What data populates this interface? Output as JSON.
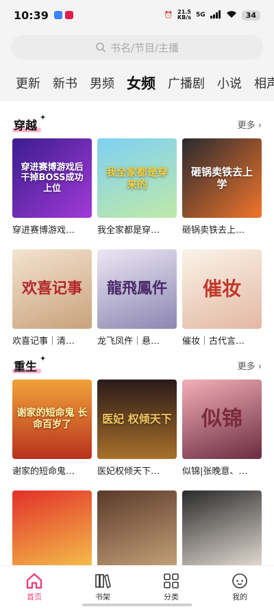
{
  "status": {
    "time": "10:39",
    "speed_value": "21.5",
    "speed_unit": "KB/s",
    "network": "5G",
    "battery": "34"
  },
  "search": {
    "placeholder": "书名/节目/主播"
  },
  "tabs": [
    "更新",
    "新书",
    "男频",
    "女频",
    "广播剧",
    "小说",
    "相声"
  ],
  "active_tab": "女频",
  "sections": [
    {
      "title": "穿越",
      "more": "更多",
      "books": [
        {
          "title": "穿进赛博游戏…",
          "cover_text": "穿进赛博游戏后 干掉BOSS成功上位",
          "colors": [
            "#3a1d8f",
            "#a23ad6"
          ]
        },
        {
          "title": "我全家都是穿…",
          "cover_text": "我全家都是穿来的",
          "colors": [
            "#7fd0f2",
            "#bfe9a8"
          ]
        },
        {
          "title": "砸锅卖铁去上…",
          "cover_text": "砸锅卖铁去上学",
          "colors": [
            "#2a2a30",
            "#f0742a"
          ]
        },
        {
          "title": "欢喜记事｜清…",
          "cover_text": "欢喜记事",
          "colors": [
            "#f3e3cf",
            "#c9a27c"
          ]
        },
        {
          "title": "龙飞凤仵｜悬…",
          "cover_text": "龍飛鳳仵",
          "colors": [
            "#ece7f4",
            "#8c86b2"
          ]
        },
        {
          "title": "催妆｜古代言…",
          "cover_text": "催妆",
          "colors": [
            "#fbf3e8",
            "#e3b8a3"
          ]
        }
      ]
    },
    {
      "title": "重生",
      "more": "更多",
      "books": [
        {
          "title": "谢家的短命鬼…",
          "cover_text": "谢家的短命鬼 长命百岁了",
          "colors": [
            "#f2a23a",
            "#b8321c"
          ]
        },
        {
          "title": "医妃权倾天下…",
          "cover_text": "医妃 权倾天下",
          "colors": [
            "#2a1a1a",
            "#a8702a"
          ]
        },
        {
          "title": "似锦|张晚意、…",
          "cover_text": "似锦",
          "colors": [
            "#f3b0b8",
            "#6b2b40"
          ]
        },
        {
          "title": "",
          "cover_text": "",
          "colors": [
            "#e2302a",
            "#f5c24a"
          ]
        },
        {
          "title": "",
          "cover_text": "",
          "colors": [
            "#5a3a2a",
            "#c7a37a"
          ]
        },
        {
          "title": "",
          "cover_text": "",
          "colors": [
            "#2a2a2a",
            "#e8e0d8"
          ]
        }
      ]
    }
  ],
  "nav": [
    {
      "label": "首页",
      "icon": "home-icon",
      "active": true
    },
    {
      "label": "书架",
      "icon": "bookshelf-icon",
      "active": false
    },
    {
      "label": "分类",
      "icon": "grid-icon",
      "active": false
    },
    {
      "label": "我的",
      "icon": "profile-icon",
      "active": false
    }
  ],
  "colors": {
    "accent": "#e8407a",
    "highlight": "#ffb8cf"
  }
}
